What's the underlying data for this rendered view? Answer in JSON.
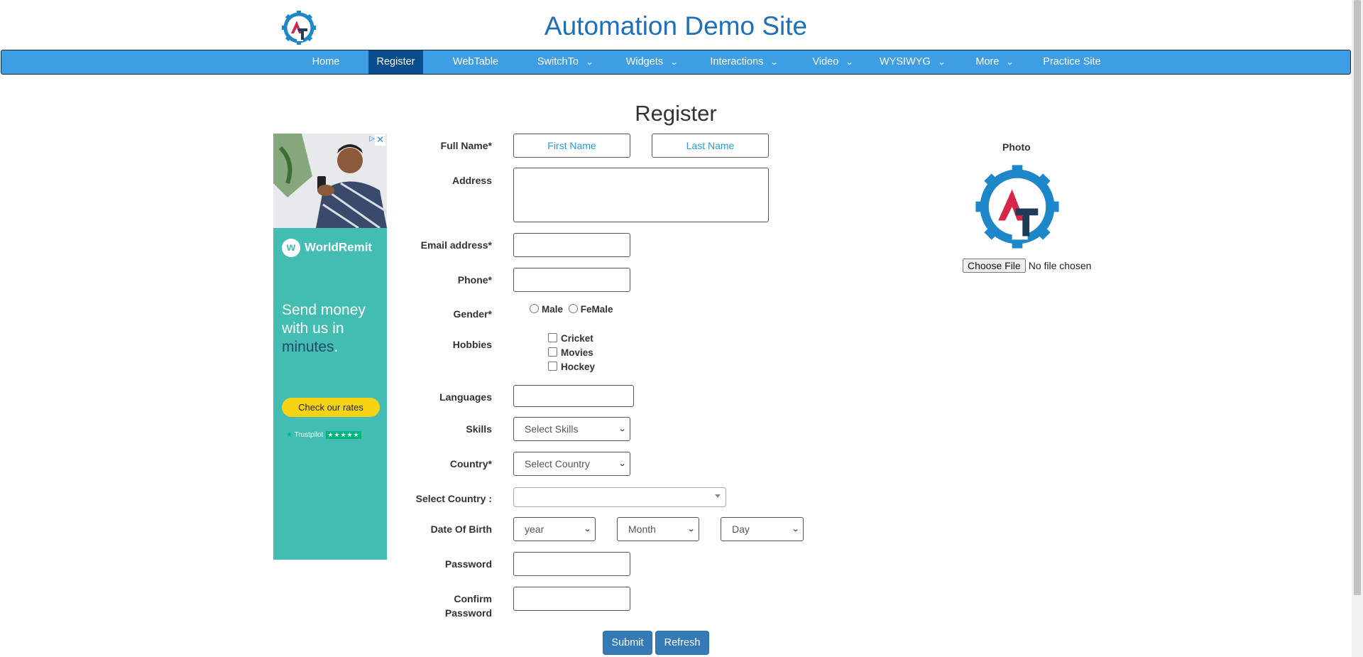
{
  "header": {
    "title": "Automation Demo Site",
    "logo_colors": {
      "gear": "#1d87c9",
      "letter_a": "#d8264a",
      "letter_t": "#1f3b57"
    }
  },
  "nav": {
    "items": [
      {
        "label": "Home",
        "has_dropdown": false,
        "active": false
      },
      {
        "label": "Register",
        "has_dropdown": false,
        "active": true
      },
      {
        "label": "WebTable",
        "has_dropdown": false,
        "active": false
      },
      {
        "label": "SwitchTo",
        "has_dropdown": true,
        "active": false
      },
      {
        "label": "Widgets",
        "has_dropdown": true,
        "active": false
      },
      {
        "label": "Interactions",
        "has_dropdown": true,
        "active": false
      },
      {
        "label": "Video",
        "has_dropdown": true,
        "active": false
      },
      {
        "label": "WYSIWYG",
        "has_dropdown": true,
        "active": false
      },
      {
        "label": "More",
        "has_dropdown": true,
        "active": false
      },
      {
        "label": "Practice Site",
        "has_dropdown": false,
        "active": false
      }
    ],
    "dropdown_icon": "chevron-down-icon",
    "colors": {
      "bar": "#3d9ee3",
      "active": "#0a4d8c"
    }
  },
  "page": {
    "heading": "Register"
  },
  "ad": {
    "brand": "WorldRemit",
    "brand_icon_letter": "w",
    "text_line1": "Send money",
    "text_line2": "with us in",
    "text_highlight": "minutes",
    "text_end": ".",
    "cta": "Check our rates",
    "trustpilot": "Trustpilot",
    "stars": "★★★★★",
    "close_icon": "✕",
    "info_icon": "▷"
  },
  "form": {
    "full_name_label": "Full Name*",
    "first_name_placeholder": "First Name",
    "last_name_placeholder": "Last Name",
    "address_label": "Address",
    "email_label": "Email address*",
    "phone_label": "Phone*",
    "gender_label": "Gender*",
    "gender_options": [
      "Male",
      "FeMale"
    ],
    "hobbies_label": "Hobbies",
    "hobbies": [
      "Cricket",
      "Movies",
      "Hockey"
    ],
    "languages_label": "Languages",
    "skills_label": "Skills",
    "skills_value": "Select Skills",
    "country_label": "Country*",
    "country_value": "Select Country",
    "select_country_label": "Select Country :",
    "dob_label": "Date Of Birth",
    "year_value": "year",
    "month_value": "Month",
    "day_value": "Day",
    "password_label": "Password",
    "confirm_password_label_1": "Confirm",
    "confirm_password_label_2": "Password",
    "submit": "Submit",
    "refresh": "Refresh"
  },
  "photo": {
    "label": "Photo",
    "choose_file": "Choose File",
    "no_file": "No file chosen"
  }
}
